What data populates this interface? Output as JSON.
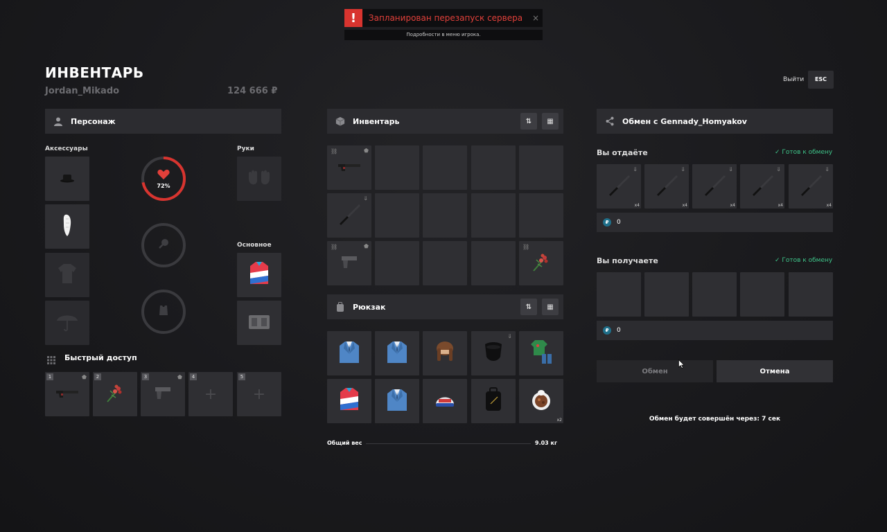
{
  "notification": {
    "title": "Запланирован перезапуск сервера",
    "subtitle": "Подробности в меню игрока.",
    "icon": "!",
    "close": "×"
  },
  "header": {
    "title": "ИНВЕНТАРЬ",
    "username": "Jordan_Mikado",
    "money": "124 666 ₽",
    "exit_label": "Выйти",
    "esc_label": "ESC"
  },
  "character": {
    "header": "Персонаж",
    "accessories_label": "Аксессуары",
    "hands_label": "Руки",
    "main_label": "Основное",
    "health_value": 0.72,
    "health_text": "72%",
    "accessory_slots": [
      "hat-icon",
      "glove-icon",
      "shirt-icon",
      "umbrella-icon"
    ],
    "hand_slot": "hands-icon",
    "main_slots": [
      "jacket-icon",
      "armor-vest-icon"
    ]
  },
  "quick_access": {
    "title": "Быстрый доступ",
    "slots": [
      {
        "num": "1",
        "icon": "pistol-silencer-icon"
      },
      {
        "num": "2",
        "icon": "flower-bouquet-icon"
      },
      {
        "num": "3",
        "icon": "pistol-icon"
      },
      {
        "num": "4",
        "icon": "plus-icon"
      },
      {
        "num": "5",
        "icon": "plus-icon"
      }
    ]
  },
  "inventory": {
    "header": "Инвентарь",
    "cells": [
      "pistol-silencer-icon",
      "",
      "",
      "",
      "",
      "knife-icon",
      "",
      "",
      "",
      "",
      "pistol-icon",
      "",
      "",
      "",
      "flower-bouquet-icon"
    ]
  },
  "backpack": {
    "header": "Рюкзак",
    "cells": [
      {
        "icon": "blue-suit-icon",
        "count": ""
      },
      {
        "icon": "blue-suit-icon",
        "count": ""
      },
      {
        "icon": "fur-hat-icon",
        "count": ""
      },
      {
        "icon": "black-mask-icon",
        "count": ""
      },
      {
        "icon": "green-outfit-icon",
        "count": ""
      },
      {
        "icon": "jacket-icon",
        "count": ""
      },
      {
        "icon": "blue-suit-icon",
        "count": ""
      },
      {
        "icon": "cap-icon",
        "count": ""
      },
      {
        "icon": "black-backpack-icon",
        "count": ""
      },
      {
        "icon": "food-plate-icon",
        "count": "x2"
      }
    ]
  },
  "weight": {
    "label": "Общий вес",
    "value": "9.03 кг"
  },
  "trade": {
    "header": "Обмен с Gennady_Homyakov",
    "give_label": "Вы отдаёте",
    "receive_label": "Вы получаете",
    "ready_label": "Готов к обмену",
    "give_items": [
      {
        "icon": "knife-icon",
        "count": "x4"
      },
      {
        "icon": "knife-icon",
        "count": "x4"
      },
      {
        "icon": "knife-icon",
        "count": "x4"
      },
      {
        "icon": "knife-icon",
        "count": "x4"
      },
      {
        "icon": "knife-icon",
        "count": "x4"
      }
    ],
    "give_money": "0",
    "receive_money": "0",
    "exchange_button": "Обмен",
    "cancel_button": "Отмена",
    "timer_text": "Обмен будет совершён через: 7 сек"
  },
  "colors": {
    "accent_red": "#d8342f",
    "ready_green": "#3fc58a",
    "ruble_teal": "#1f6f8a"
  }
}
